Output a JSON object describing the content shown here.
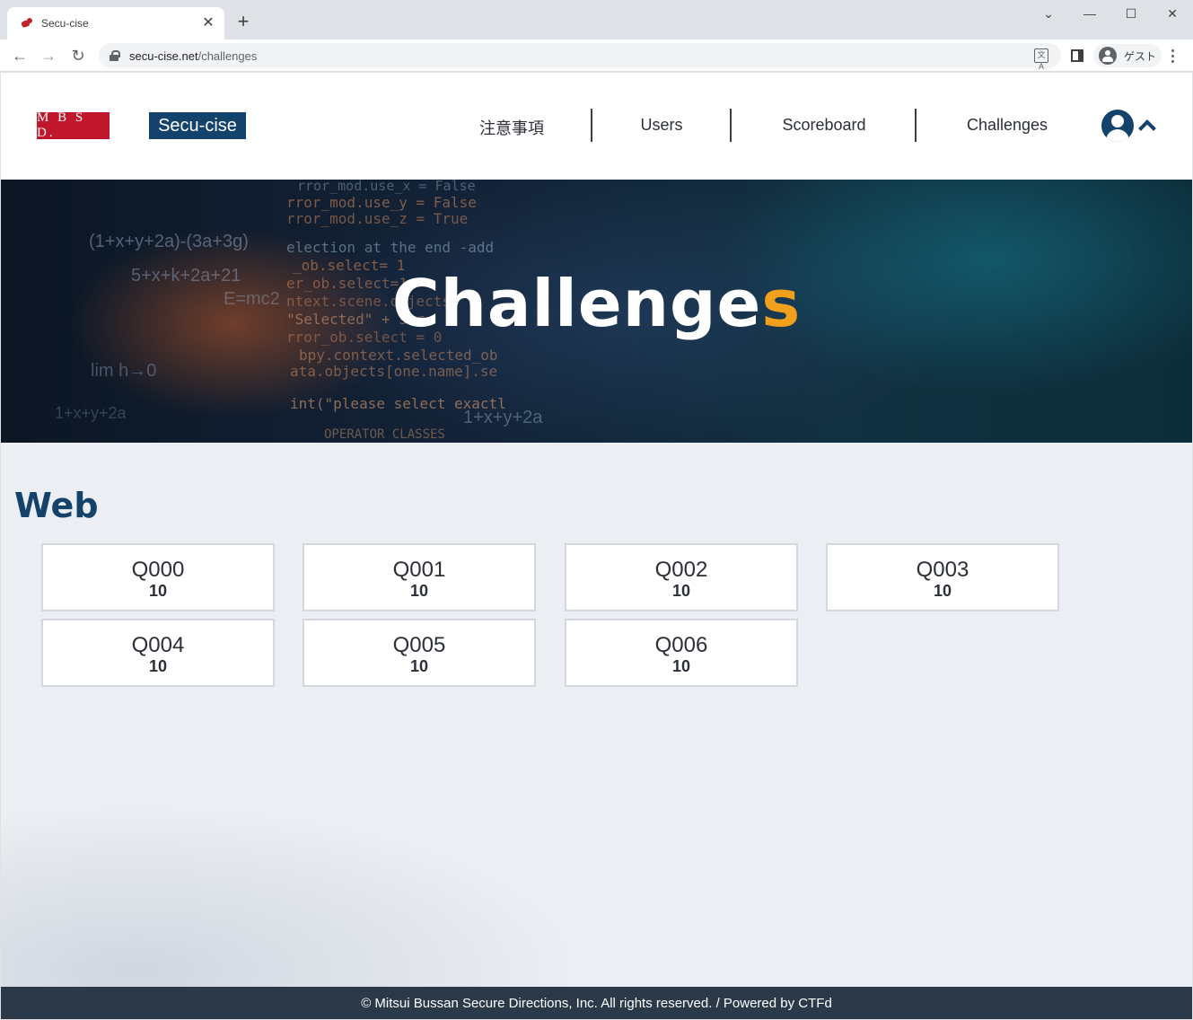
{
  "browser": {
    "tab_title": "Secu-cise",
    "url_host": "secu-cise.net",
    "url_path": "/challenges",
    "profile_label": "ゲスト"
  },
  "header": {
    "logo_text": "M B S D.",
    "brand": "Secu-cise",
    "nav": [
      "注意事項",
      "Users",
      "Scoreboard",
      "Challenges"
    ]
  },
  "hero": {
    "title_main": "Challenge",
    "title_accent": "s",
    "code_lines": [
      "rror_mod.use_x = False",
      "rror_mod.use_y = False",
      "rror_mod.use_z = True",
      "election at the end -add",
      "_ob.select= 1",
      "er_ob.select=1",
      "ntext.scene.objects",
      "\"Selected\" + str",
      "rror_ob.select = 0",
      "bpy.context.selected_ob",
      "ata.objects[one.name].se",
      "int(\"please select exactl",
      "OPERATOR CLASSES",
      "(1+x+y+2a)-(3a+3g)",
      "5+x+k+2a+21",
      "E=mc2",
      "lim h→0",
      "1+x+y+2a",
      "1+x+y+2a"
    ]
  },
  "section": {
    "title": "Web"
  },
  "challenges": [
    {
      "name": "Q000",
      "points": "10"
    },
    {
      "name": "Q001",
      "points": "10"
    },
    {
      "name": "Q002",
      "points": "10"
    },
    {
      "name": "Q003",
      "points": "10"
    },
    {
      "name": "Q004",
      "points": "10"
    },
    {
      "name": "Q005",
      "points": "10"
    },
    {
      "name": "Q006",
      "points": "10"
    }
  ],
  "footer": {
    "text": "© Mitsui Bussan Secure Directions, Inc. All rights reserved. / Powered by CTFd"
  },
  "colors": {
    "brand_navy": "#13426b",
    "mbsd_red": "#c0172d",
    "accent_orange": "#f0a01c",
    "footer_bg": "#2b3949"
  }
}
